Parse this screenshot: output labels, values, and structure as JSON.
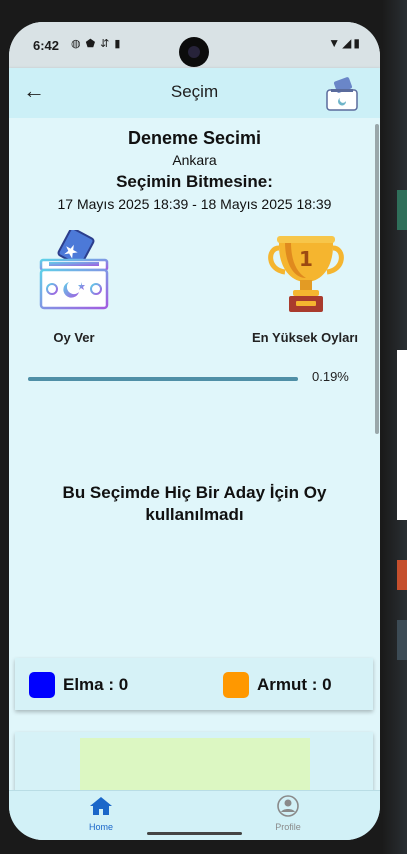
{
  "status_bar": {
    "time": "6:42",
    "left_icons": [
      "shield-icon",
      "vpn-icon",
      "data-saver-icon",
      "sd-card-icon"
    ],
    "right_icons": [
      "wifi-icon",
      "signal-icon",
      "battery-icon"
    ]
  },
  "app_bar": {
    "title": "Seçim",
    "back_icon": "arrow-left-icon",
    "logo_icon": "ballot-box-logo"
  },
  "election": {
    "name": "Deneme Secimi",
    "city": "Ankara",
    "countdown_label": "Seçimin Bitmesine:",
    "date_range": "17 Mayıs 2025 18:39 - 18 Mayıs 2025 18:39"
  },
  "actions": {
    "vote_label": "Oy Ver",
    "vote_icon": "ballot-box-icon",
    "top_label": "En Yüksek Oyları",
    "top_icon": "trophy-icon",
    "trophy_number": "1"
  },
  "progress": {
    "percent_text": "0.19%",
    "fraction": 0.0019
  },
  "no_votes_message": "Bu Seçimde Hiç Bir Aday İçin Oy kullanılmadı",
  "legend": [
    {
      "label": "Elma : 0",
      "color": "#0000ff"
    },
    {
      "label": "Armut : 0",
      "color": "#ff9800"
    }
  ],
  "bottom_nav": {
    "home_label": "Home",
    "home_icon": "home-icon",
    "profile_label": "Profile",
    "profile_icon": "profile-icon",
    "active_color": "#1b67c9"
  }
}
